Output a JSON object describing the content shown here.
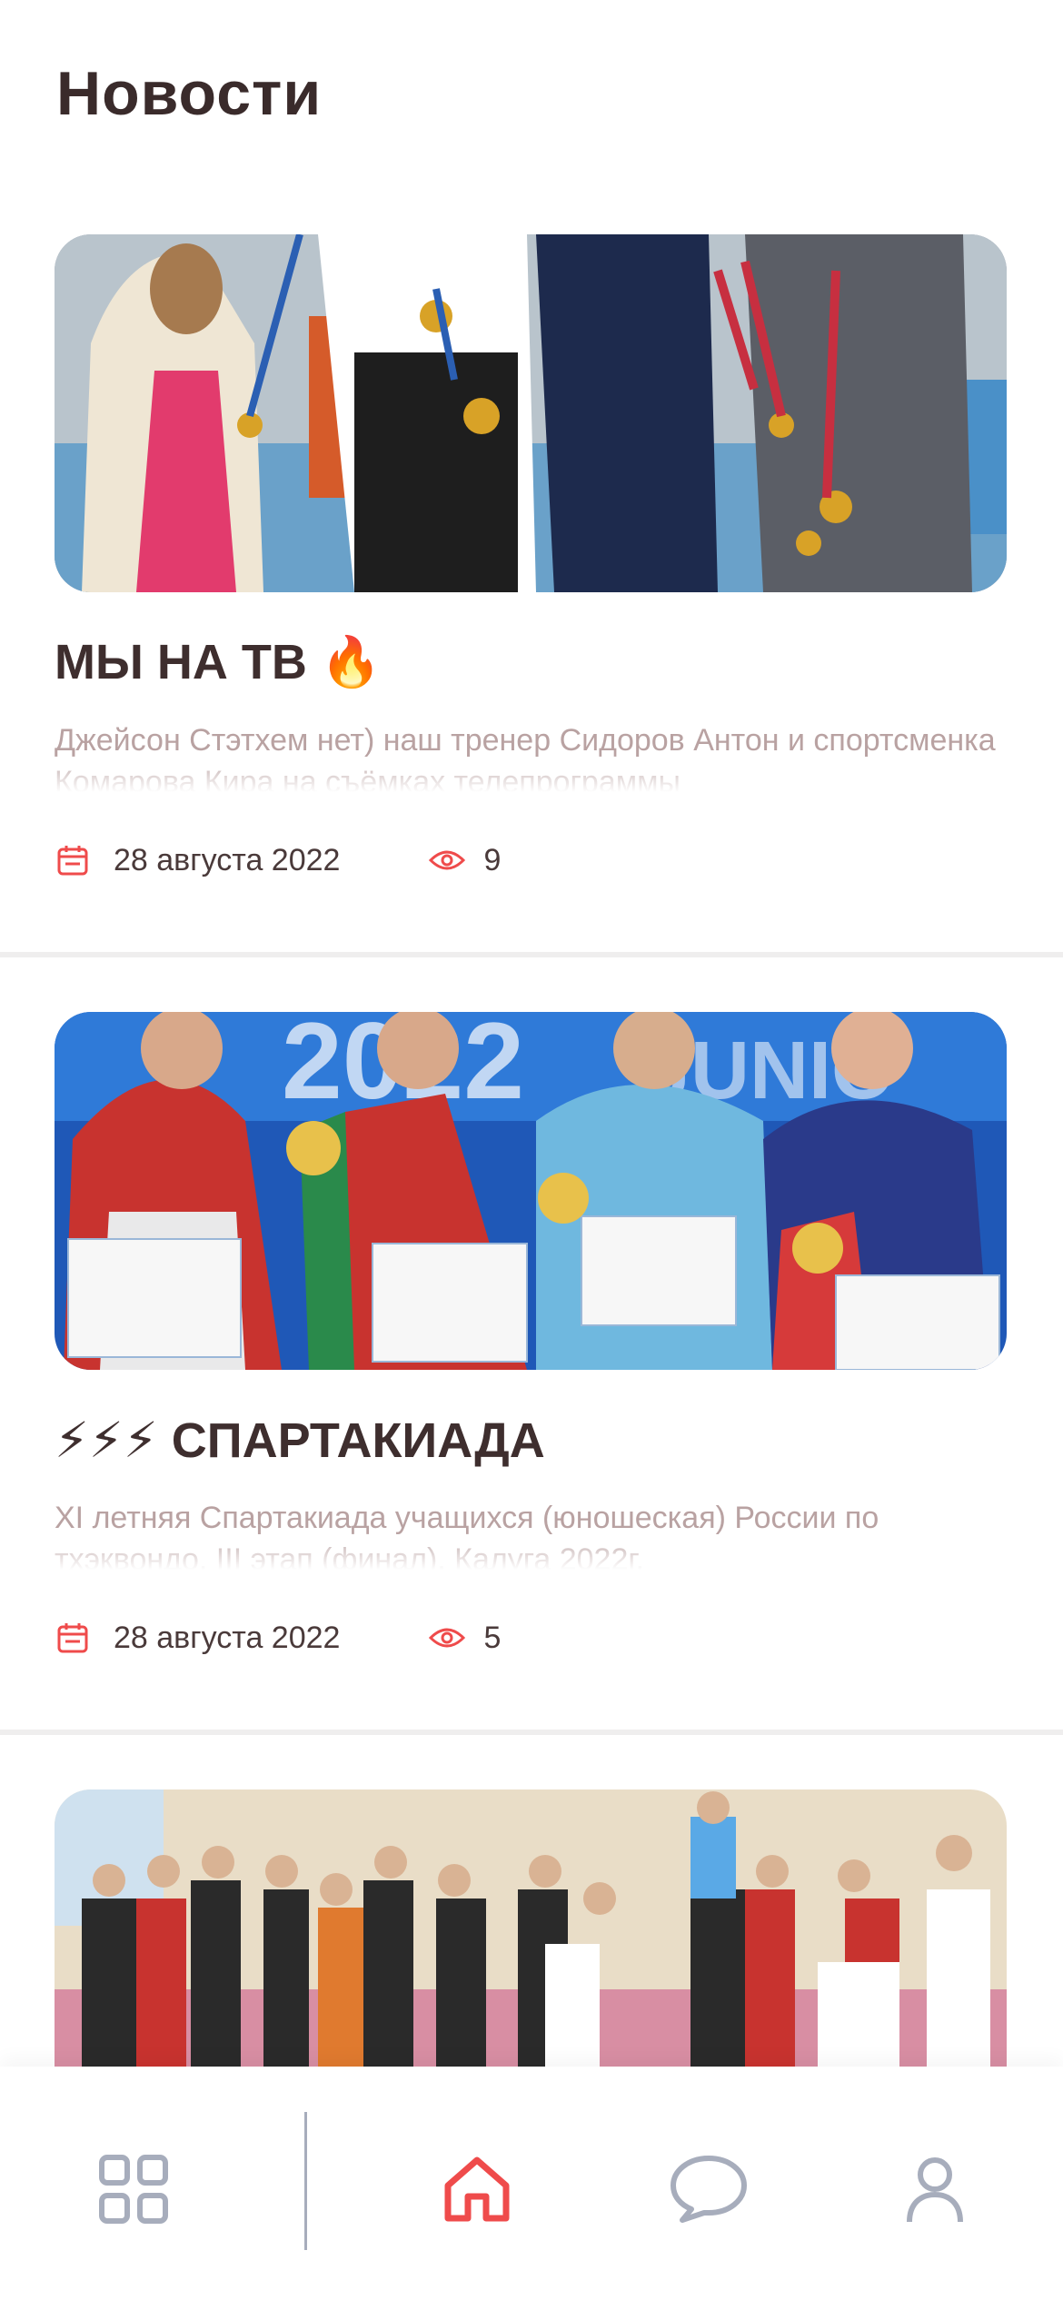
{
  "header": {
    "title": "Новости"
  },
  "news": [
    {
      "title_text": "МЫ НА ТВ",
      "title_emoji": "🔥",
      "description": "Джейсон Стэтхем нет) наш тренер Сидоров Антон и спортсменка Комарова Кира на съёмках телепрограммы",
      "date": "28 августа 2022",
      "views": "9",
      "image": "Фото: тренер и спортсмены с медалями в телестудии"
    },
    {
      "title_emoji": "⚡⚡⚡",
      "title_text": "СПАРТАКИАДА",
      "description": "XI летняя Спартакиада учащихся (юношеская) России по тхэквондо. III этап (финал). Калуга 2022г.",
      "date": "28 августа 2022",
      "views": "5",
      "image": "Фото: призёры с флагами и сертификатами"
    },
    {
      "image": "Фото: групповое фото спортсменов в зале"
    }
  ],
  "tabbar": {
    "tabs": [
      "grid-icon",
      "home-icon",
      "chat-icon",
      "profile-icon"
    ],
    "active": "home-icon"
  },
  "colors": {
    "accent": "#ef4b4b",
    "inactive": "#a7adbc",
    "title": "#3a2b2b",
    "muted": "#b9a2a2"
  }
}
